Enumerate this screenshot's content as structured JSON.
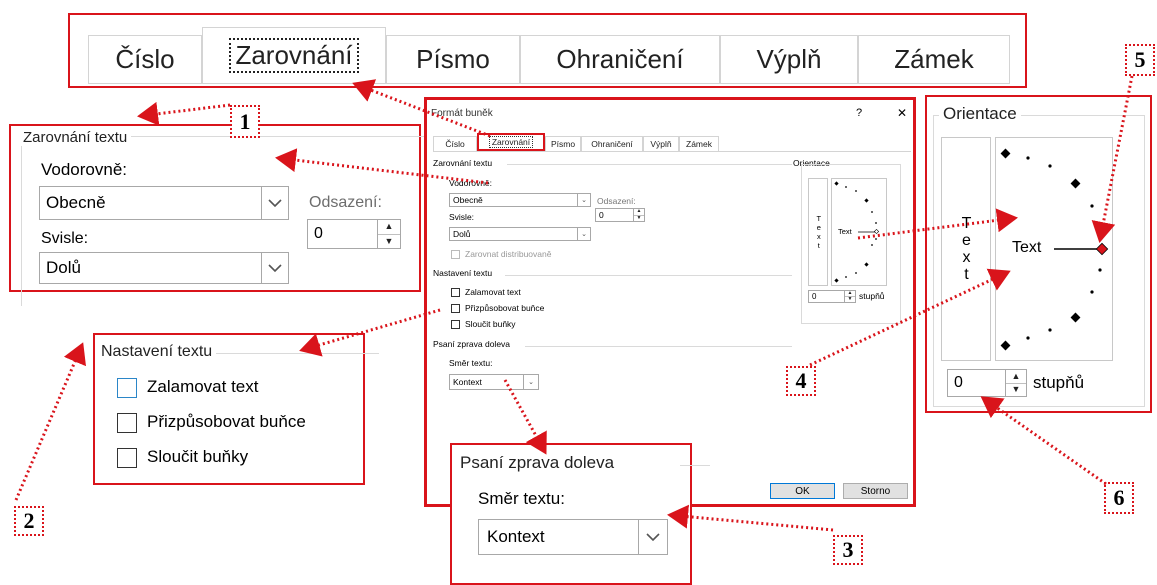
{
  "top_tabs": [
    "Číslo",
    "Zarovnání",
    "Písmo",
    "Ohraničení",
    "Výplň",
    "Zámek"
  ],
  "callout1": {
    "number": "1",
    "group_title": "Zarovnání textu",
    "horizontal_label": "Vodorovně:",
    "horizontal_value": "Obecně",
    "indent_label": "Odsazení:",
    "indent_value": "0",
    "vertical_label": "Svisle:",
    "vertical_value": "Dolů"
  },
  "callout2": {
    "number": "2",
    "group_title": "Nastavení textu",
    "wrap": "Zalamovat text",
    "shrink": "Přizpůsobovat buňce",
    "merge": "Sloučit buňky"
  },
  "callout3": {
    "number": "3",
    "group_title": "Psaní zprava doleva",
    "direction_label": "Směr textu:",
    "direction_value": "Kontext"
  },
  "callout4": {
    "number": "4"
  },
  "callout5": {
    "number": "5"
  },
  "callout6": {
    "number": "6"
  },
  "orientation": {
    "title": "Orientace",
    "vertical_text": "Text",
    "sample_text": "Text",
    "degrees_value": "0",
    "degrees_label": "stupňů"
  },
  "dialog": {
    "title": "Formát buněk",
    "help": "?",
    "close": "✕",
    "tabs": [
      "Číslo",
      "Zarovnání",
      "Písmo",
      "Ohraničení",
      "Výplň",
      "Zámek"
    ],
    "align_group": "Zarovnání textu",
    "horizontal_label": "Vodorovně:",
    "horizontal_value": "Obecně",
    "indent_label": "Odsazení:",
    "indent_value": "0",
    "vertical_label": "Svisle:",
    "vertical_value": "Dolů",
    "distributed": "Zarovnat distribuovaně",
    "text_group": "Nastavení textu",
    "wrap": "Zalamovat text",
    "shrink": "Přizpůsobovat buňce",
    "merge": "Sloučit buňky",
    "rtl_group": "Psaní zprava doleva",
    "direction_label": "Směr textu:",
    "direction_value": "Kontext",
    "orientation_title": "Orientace",
    "orientation_vertical_text": "Text",
    "orientation_sample": "Text",
    "degrees_value": "0",
    "degrees_label": "stupňů",
    "ok": "OK",
    "cancel": "Storno"
  },
  "colors": {
    "callout_border": "#d9141b",
    "focus_blue": "#2b86c8",
    "diamond_red": "#d9141b"
  },
  "icons": [
    "chevron-down-icon",
    "spin-up-icon",
    "spin-down-icon",
    "help-icon",
    "close-icon"
  ]
}
